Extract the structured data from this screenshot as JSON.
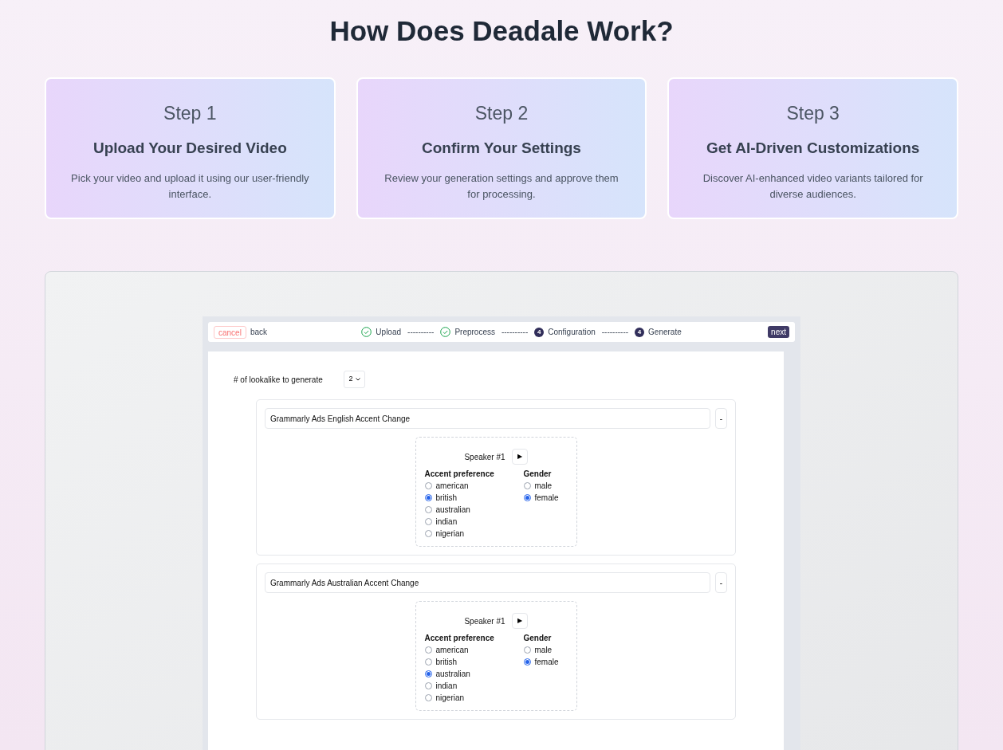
{
  "title": "How Does Deadale Work?",
  "steps": [
    {
      "step": "Step 1",
      "heading": "Upload Your Desired Video",
      "text": "Pick your video and upload it using our user-friendly interface."
    },
    {
      "step": "Step 2",
      "heading": "Confirm Your Settings",
      "text": "Review your generation settings and approve them for processing."
    },
    {
      "step": "Step 3",
      "heading": "Get AI-Driven Customizations",
      "text": "Discover AI-enhanced video variants tailored for diverse audiences."
    }
  ],
  "demo": {
    "cancel": "cancel",
    "back": "back",
    "next": "next",
    "progress": [
      {
        "label": "Upload",
        "kind": "done"
      },
      {
        "kind": "separator",
        "label": "----------"
      },
      {
        "label": "Preprocess",
        "kind": "done"
      },
      {
        "kind": "separator",
        "label": "----------"
      },
      {
        "label": "Configuration",
        "kind": "numbered",
        "number": "4"
      },
      {
        "kind": "separator",
        "label": "----------"
      },
      {
        "label": "Generate",
        "kind": "numbered",
        "number": "4"
      }
    ],
    "count_label": "# of lookalike to generate",
    "count_value": "2",
    "variants": [
      {
        "name": "Grammarly Ads English Accent Change",
        "remove": "-",
        "speaker": "Speaker #1",
        "play": "▶",
        "accent_label": "Accent preference",
        "gender_label": "Gender",
        "accents": [
          {
            "label": "american",
            "selected": false
          },
          {
            "label": "british",
            "selected": true
          },
          {
            "label": "australian",
            "selected": false
          },
          {
            "label": "indian",
            "selected": false
          },
          {
            "label": "nigerian",
            "selected": false
          }
        ],
        "genders": [
          {
            "label": "male",
            "selected": false
          },
          {
            "label": "female",
            "selected": true
          }
        ]
      },
      {
        "name": "Grammarly Ads Australian Accent Change",
        "remove": "-",
        "speaker": "Speaker #1",
        "play": "▶",
        "accent_label": "Accent preference",
        "gender_label": "Gender",
        "accents": [
          {
            "label": "american",
            "selected": false
          },
          {
            "label": "british",
            "selected": false
          },
          {
            "label": "australian",
            "selected": true
          },
          {
            "label": "indian",
            "selected": false
          },
          {
            "label": "nigerian",
            "selected": false
          }
        ],
        "genders": [
          {
            "label": "male",
            "selected": false
          },
          {
            "label": "female",
            "selected": true
          }
        ]
      }
    ]
  }
}
